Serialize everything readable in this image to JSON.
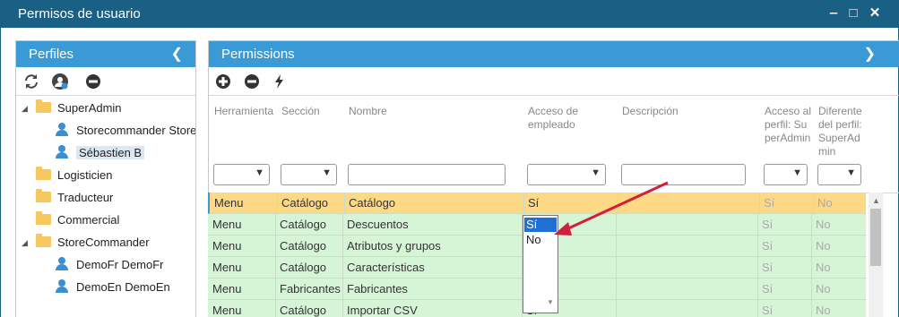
{
  "window": {
    "title": "Permisos de usuario"
  },
  "profiles": {
    "title": "Perfiles",
    "tree": [
      {
        "label": "SuperAdmin",
        "type": "folder"
      },
      {
        "label": "Storecommander Store",
        "type": "user"
      },
      {
        "label": "Sébastien B",
        "type": "user",
        "selected": true
      },
      {
        "label": "Logisticien",
        "type": "folder"
      },
      {
        "label": "Traducteur",
        "type": "folder"
      },
      {
        "label": "Commercial",
        "type": "folder"
      },
      {
        "label": "StoreCommander",
        "type": "folder"
      },
      {
        "label": "DemoFr DemoFr",
        "type": "user"
      },
      {
        "label": "DemoEn DemoEn",
        "type": "user"
      }
    ]
  },
  "permissions": {
    "title": "Permissions",
    "columns": {
      "herramienta": "Herramienta",
      "seccion": "Sección",
      "nombre": "Nombre",
      "acceso": "Acceso de empleado",
      "descripcion": "Descripción",
      "acceso_perfil": "Acceso al perfil: SuperAdmin",
      "diferente": "Diferente del perfil: SuperAdmin"
    },
    "rows": [
      [
        "Menu",
        "Catálogo",
        "Catálogo",
        "Sí",
        "",
        "Sí",
        "No"
      ],
      [
        "Menu",
        "Catálogo",
        "Descuentos",
        "",
        "",
        "Sí",
        "No"
      ],
      [
        "Menu",
        "Catálogo",
        "Atributos y grupos",
        "",
        "",
        "Sí",
        "No"
      ],
      [
        "Menu",
        "Catálogo",
        "Características",
        "",
        "",
        "Sí",
        "No"
      ],
      [
        "Menu",
        "Fabricantes",
        "Fabricantes",
        "",
        "",
        "Sí",
        "No"
      ],
      [
        "Menu",
        "Catálogo",
        "Importar CSV",
        "Sí",
        "",
        "Sí",
        "No"
      ]
    ],
    "dropdown_options": [
      "Sí",
      "No"
    ]
  },
  "colors": {
    "titlebar": "#1a5f84",
    "panel_header": "#3a9ad6",
    "row_green": "#d6f5d6",
    "row_selected": "#fed985",
    "annotation_arrow": "#d0203a"
  }
}
